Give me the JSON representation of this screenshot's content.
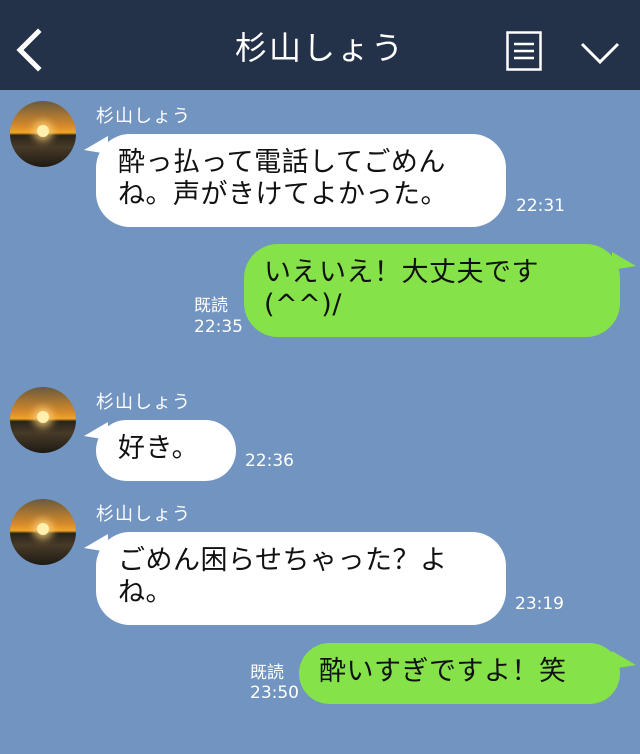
{
  "header": {
    "title": "杉山しょう",
    "background": "#243249",
    "icons": {
      "back": "chevron-left-icon",
      "menu": "list-icon",
      "collapse": "chevron-down-icon"
    }
  },
  "chat": {
    "background": "#7294c1",
    "bubble_colors": {
      "received": "#ffffff",
      "sent": "#85e249"
    },
    "messages": [
      {
        "sender": "杉山しょう",
        "direction": "received",
        "text": "酔っ払って電話してごめんね。声がきけてよかった。",
        "time": "22:31",
        "read": ""
      },
      {
        "sender": "",
        "direction": "sent",
        "text": "いえいえ！大丈夫です(^^)/",
        "time": "22:35",
        "read": "既読"
      },
      {
        "sender": "杉山しょう",
        "direction": "received",
        "text": "好き。",
        "time": "22:36",
        "read": ""
      },
      {
        "sender": "杉山しょう",
        "direction": "received",
        "text": "ごめん困らせちゃった？よね。",
        "time": "23:19",
        "read": ""
      },
      {
        "sender": "",
        "direction": "sent",
        "text": "酔いすぎですよ！笑",
        "time": "23:50",
        "read": "既読"
      }
    ]
  }
}
